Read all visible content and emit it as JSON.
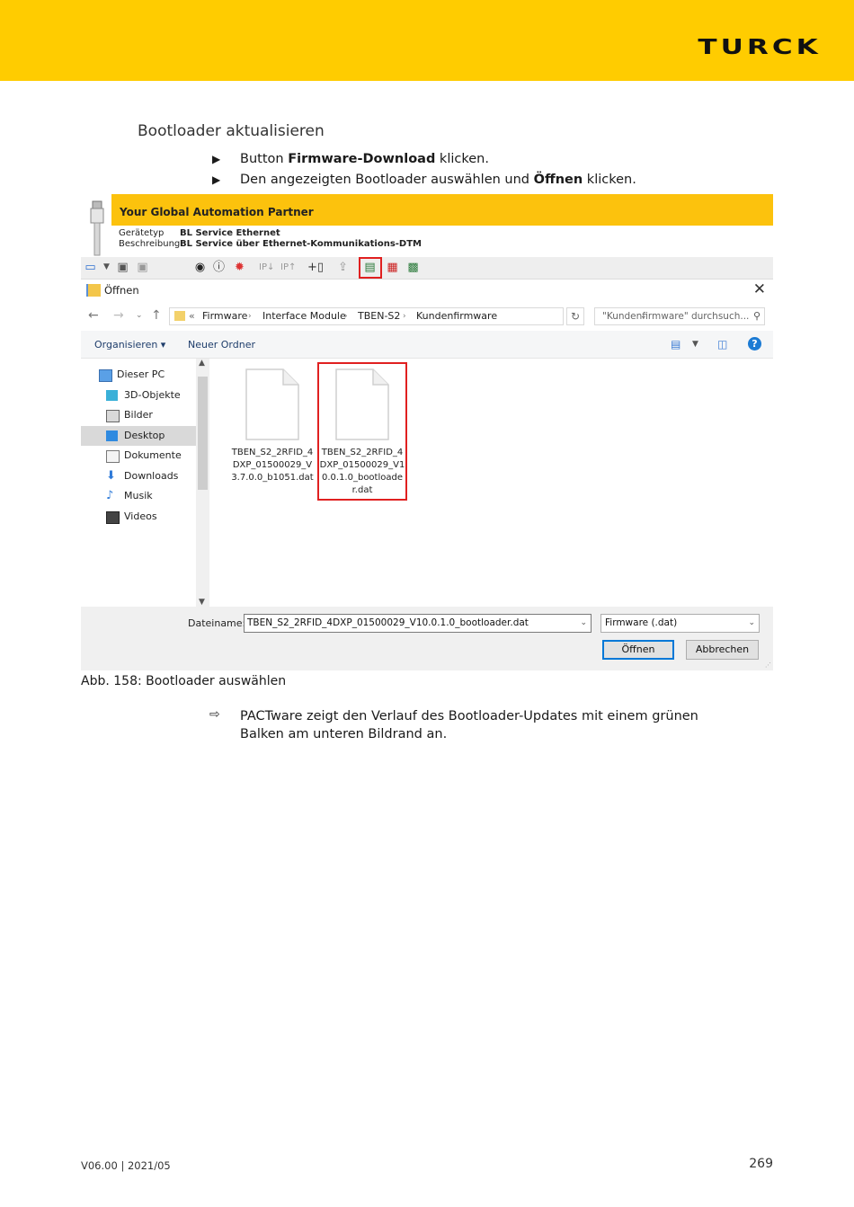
{
  "header": {
    "brand": "TURCK"
  },
  "section": {
    "title": "Bootloader aktualisieren",
    "steps": [
      {
        "pre": "Button ",
        "bold": "Firmware-Download",
        "post": " klicken."
      },
      {
        "pre": "Den angezeigten Bootloader auswählen und ",
        "bold": "Öffnen",
        "post": " klicken."
      }
    ]
  },
  "screenshot": {
    "banner": "Your Global Automation Partner",
    "device_type_label": "Gerätetyp",
    "device_type_value": "BL Service Ethernet",
    "description_label": "Beschreibung",
    "description_value": "BL Service über Ethernet-Kommunikations-DTM",
    "dialog_title": "Öffnen",
    "close_symbol": "✕",
    "breadcrumb": [
      "«",
      "Firmware",
      "Interface Module",
      "TBEN-S2",
      "Kundenfirmware"
    ],
    "search_placeholder": "\"Kundenfirmware\" durchsuch...",
    "commands": {
      "organize": "Organisieren ▾",
      "new_folder": "Neuer Ordner"
    },
    "nav_items": [
      {
        "label": "Dieser PC",
        "icon": "pc-icon"
      },
      {
        "label": "3D-Objekte",
        "icon": "cube-icon"
      },
      {
        "label": "Bilder",
        "icon": "image-icon"
      },
      {
        "label": "Desktop",
        "icon": "desktop-icon",
        "selected": true
      },
      {
        "label": "Dokumente",
        "icon": "document-icon"
      },
      {
        "label": "Downloads",
        "icon": "download-icon"
      },
      {
        "label": "Musik",
        "icon": "music-icon"
      },
      {
        "label": "Videos",
        "icon": "video-icon"
      }
    ],
    "files": [
      {
        "name": "TBEN_S2_2RFID_4DXP_01500029_V3.7.0.0_b1051.dat",
        "selected": false
      },
      {
        "name": "TBEN_S2_2RFID_4DXP_01500029_V10.0.1.0_bootloader.dat",
        "selected": true
      }
    ],
    "filename_label": "Dateiname:",
    "filename_value": "TBEN_S2_2RFID_4DXP_01500029_V10.0.1.0_bootloader.dat",
    "filetype_value": "Firmware (.dat)",
    "open_button": "Öffnen",
    "cancel_button": "Abbrechen"
  },
  "caption": "Abb. 158: Bootloader auswählen",
  "result_text": "PACTware zeigt den Verlauf des Bootloader-Updates mit einem grünen Balken am unteren Bildrand an.",
  "footer": {
    "version": "V06.00 | 2021/05",
    "page": "269"
  },
  "colors": {
    "brand_yellow": "#ffcc00",
    "highlight_red": "#e02020",
    "accent_blue": "#0078d7"
  }
}
